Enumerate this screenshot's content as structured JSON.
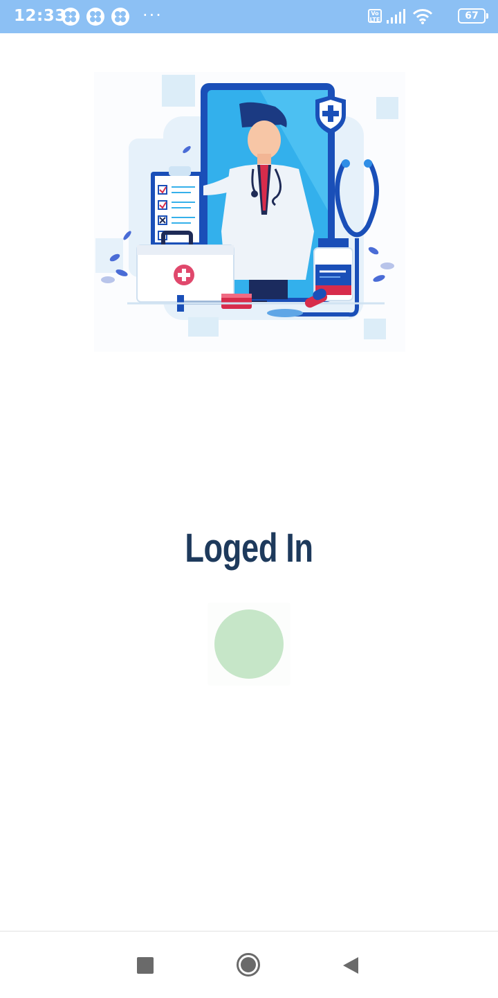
{
  "status_bar": {
    "time": "12:33",
    "app_icons": [
      "clover-app-icon",
      "clover-app-icon",
      "clover-app-icon"
    ],
    "more_indicator": "···",
    "volte_label": "Vo LTE",
    "battery_level": "67",
    "background_color": "#8cc0f4"
  },
  "main": {
    "illustration": "doctor-telemedicine-illustration",
    "title": "Loged In",
    "title_color": "#1e3a5c",
    "loader": "loading-indicator"
  },
  "navigation": {
    "recents": "square-icon",
    "home": "circle-icon",
    "back": "triangle-back-icon"
  }
}
